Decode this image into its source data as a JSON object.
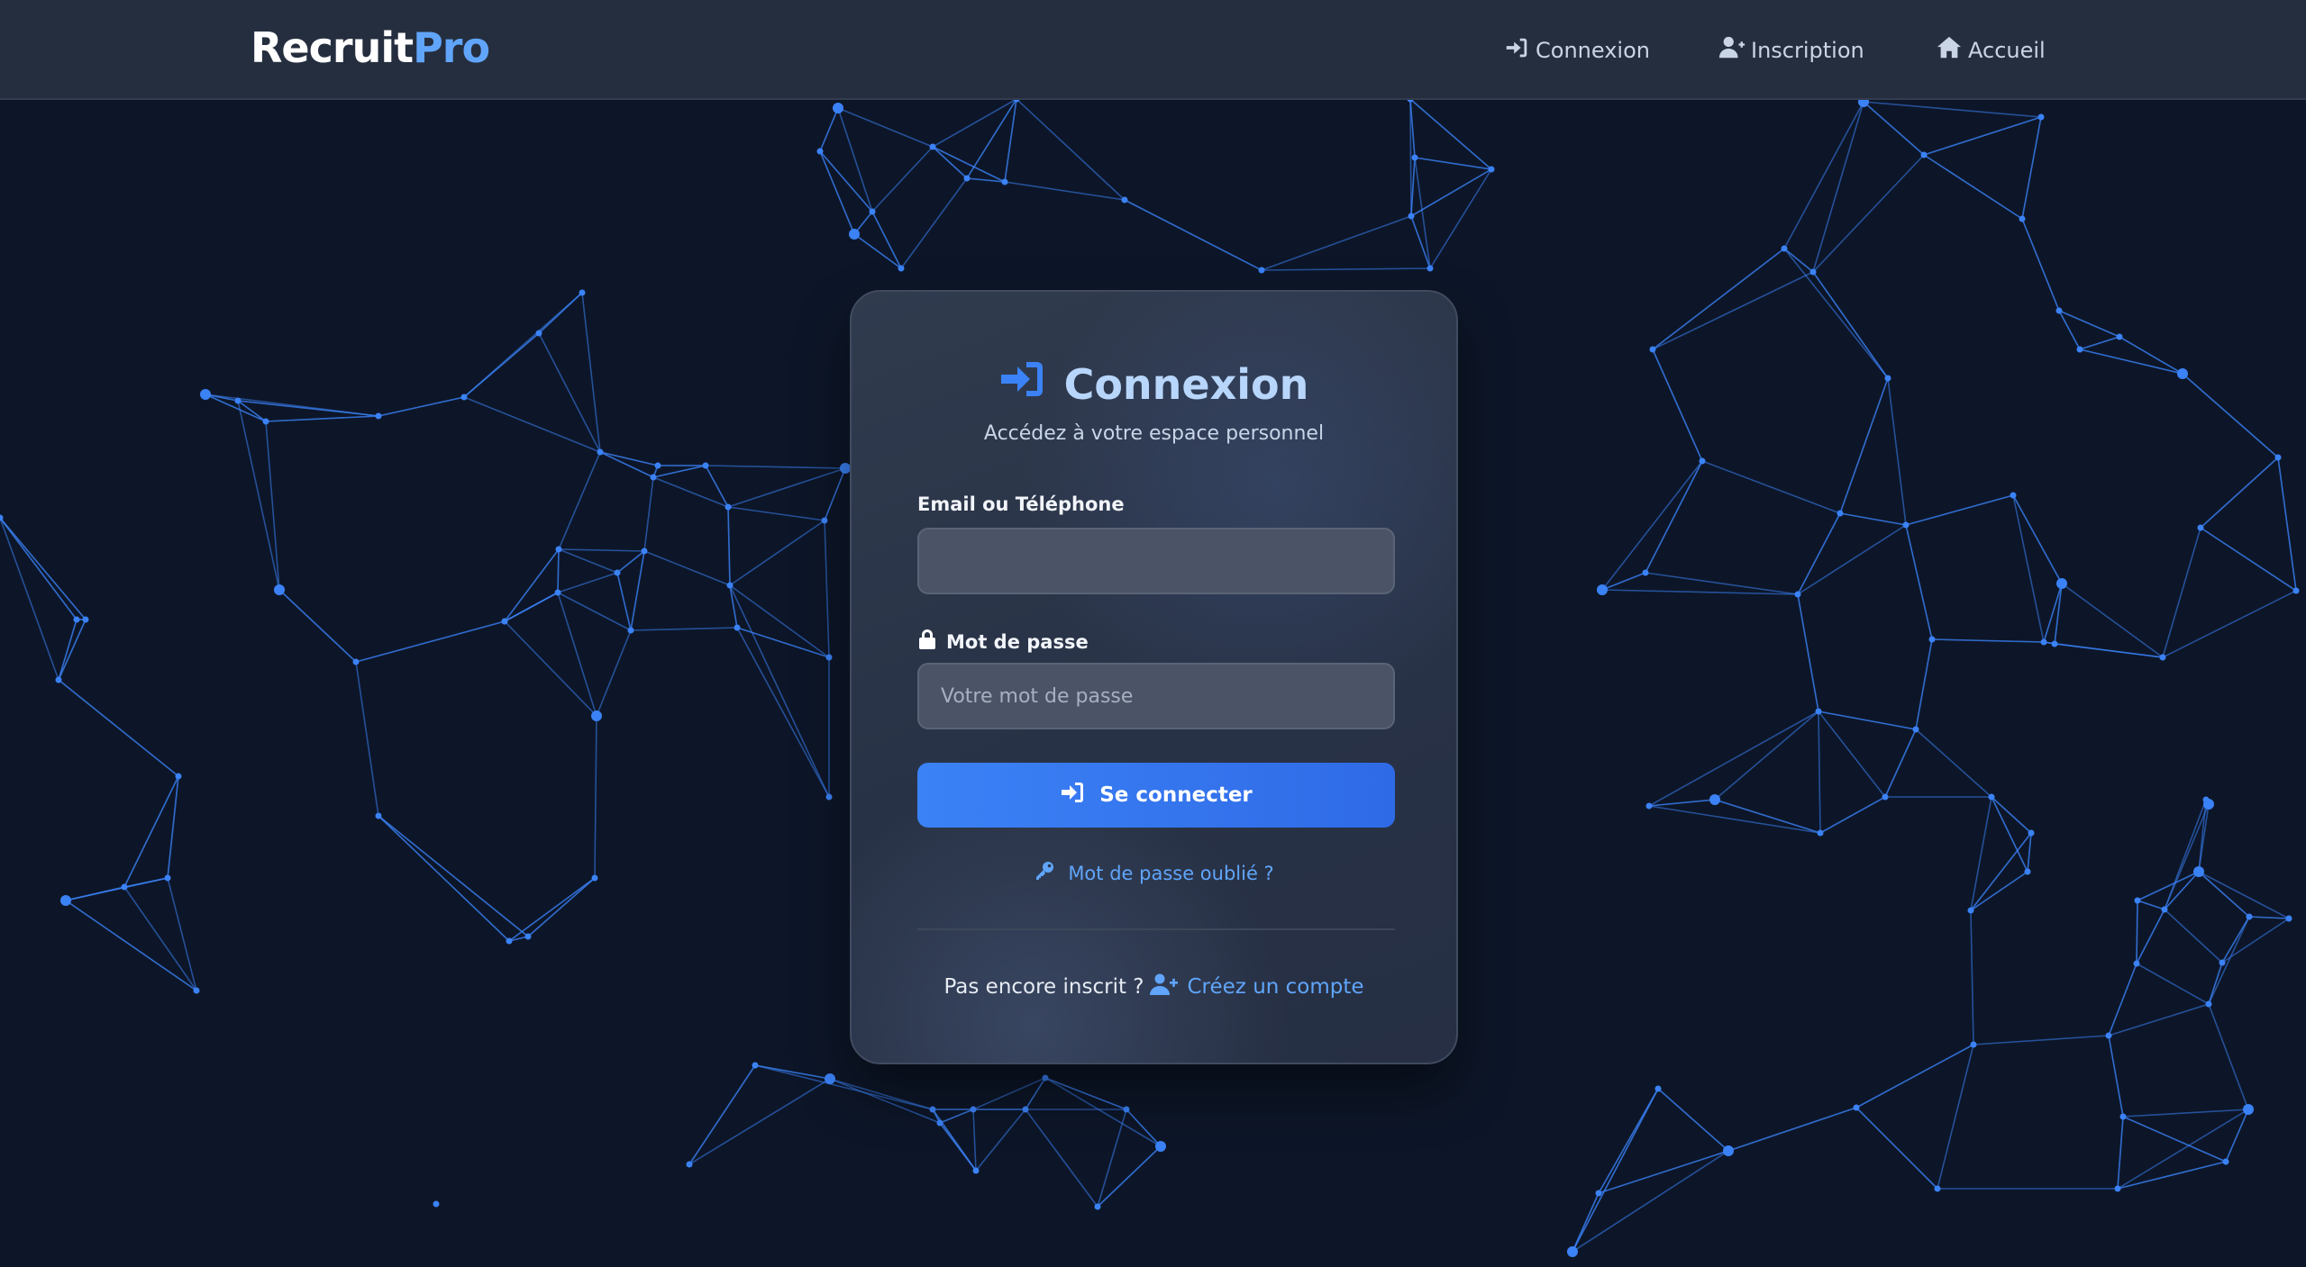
{
  "brand": {
    "part1": "Recruit",
    "part2": "Pro"
  },
  "nav": {
    "login": {
      "label": "Connexion",
      "icon": "sign-in-icon"
    },
    "register": {
      "label": "Inscription",
      "icon": "user-plus-icon"
    },
    "home": {
      "label": "Accueil",
      "icon": "home-icon"
    }
  },
  "login_card": {
    "title": "Connexion",
    "subtitle": "Accédez à votre espace personnel",
    "email_label": "Email ou Téléphone",
    "email_value": "",
    "email_placeholder": "",
    "password_label": "Mot de passe",
    "password_value": "",
    "password_placeholder": "Votre mot de passe",
    "submit_label": "Se connecter",
    "forgot_label": "Mot de passe oublié ?",
    "signup_prompt": "Pas encore inscrit ?",
    "signup_link": "Créez un compte"
  },
  "colors": {
    "page_bg": "#0d1628",
    "navbar_bg": "#252e3f",
    "accent": "#3b82f6",
    "link": "#60a5fa",
    "title": "#b8d6fb"
  }
}
